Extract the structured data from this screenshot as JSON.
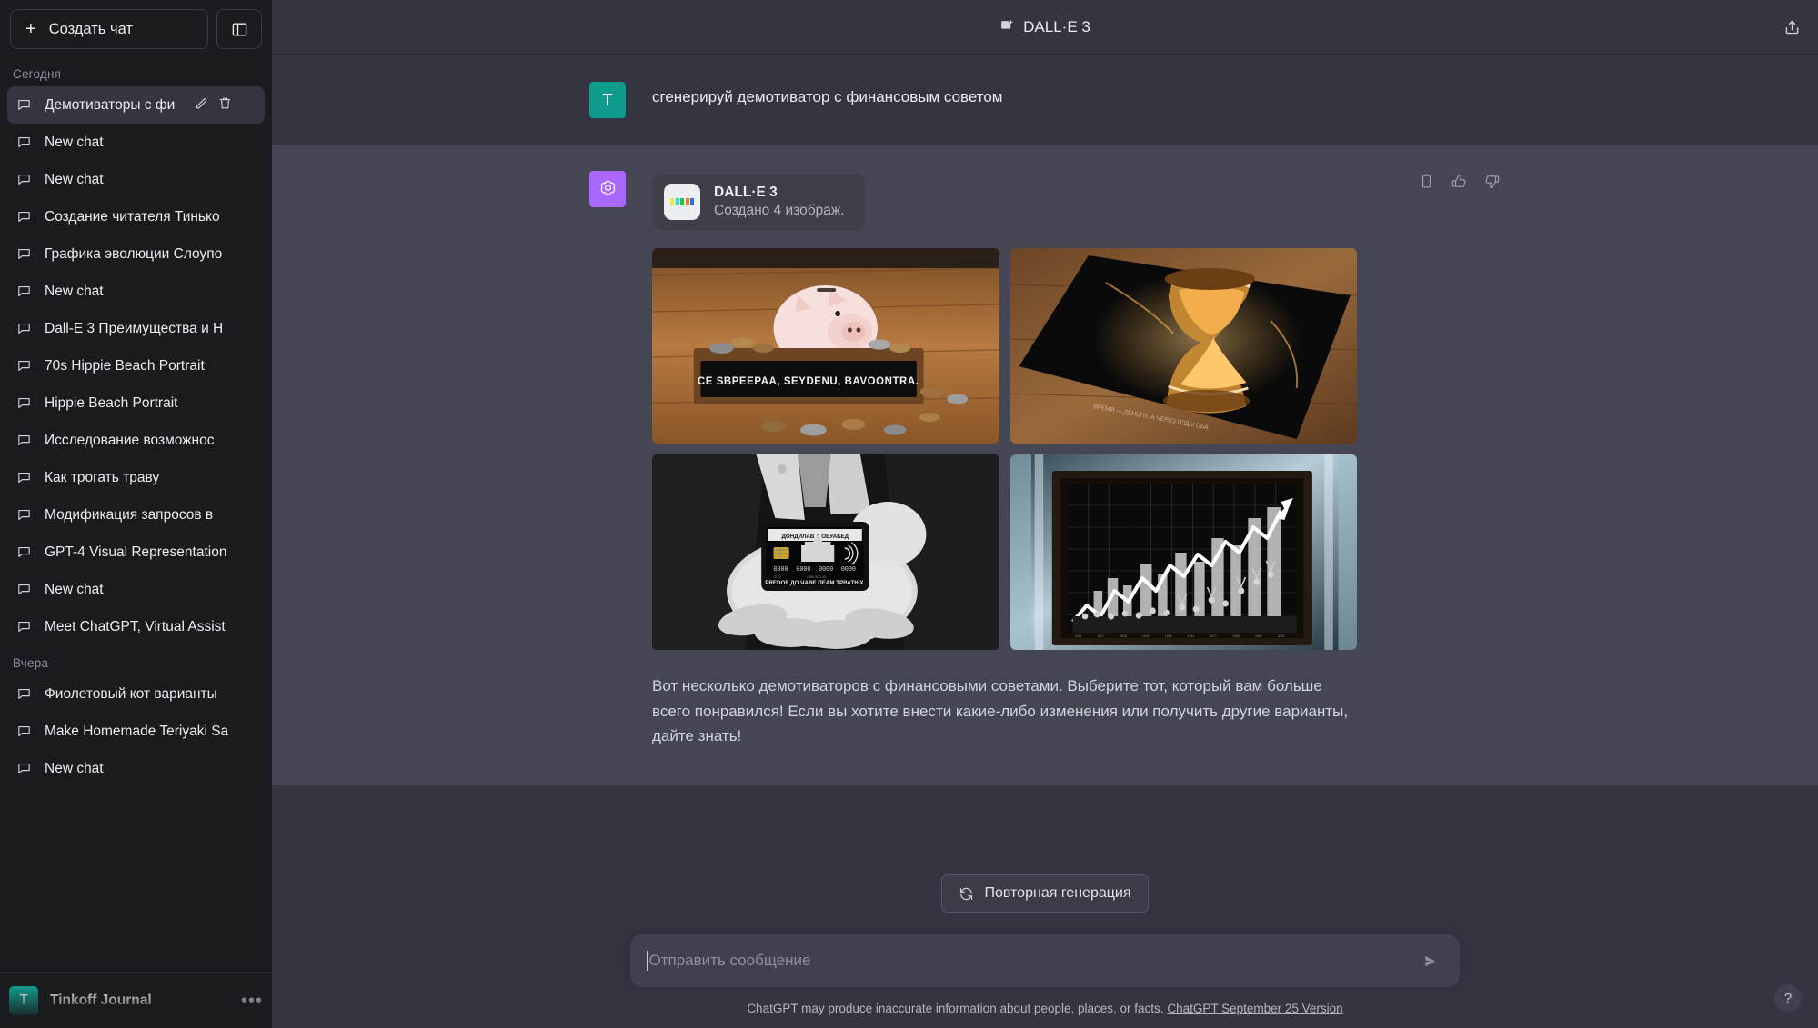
{
  "sidebar": {
    "new_chat_label": "Создать чат",
    "plus_icon": "plus-icon",
    "collapse_icon": "panel-toggle-icon",
    "groups": [
      {
        "label": "Сегодня",
        "items": [
          {
            "label": "Демотиваторы с фи",
            "active": true
          },
          {
            "label": "New chat",
            "active": false
          },
          {
            "label": "New chat",
            "active": false
          },
          {
            "label": "Создание читателя Тинько",
            "active": false
          },
          {
            "label": "Графика эволюции Слоупо",
            "active": false
          },
          {
            "label": "New chat",
            "active": false
          },
          {
            "label": "Dall-E 3 Преимущества и Н",
            "active": false
          },
          {
            "label": "70s Hippie Beach Portrait",
            "active": false
          },
          {
            "label": "Hippie Beach Portrait",
            "active": false
          },
          {
            "label": "Исследование возможнос",
            "active": false
          },
          {
            "label": "Как трогать траву",
            "active": false
          },
          {
            "label": "Модификация запросов в",
            "active": false
          },
          {
            "label": "GPT-4 Visual Representation",
            "active": false
          },
          {
            "label": "New chat",
            "active": false
          },
          {
            "label": "Meet ChatGPT, Virtual Assist",
            "active": false
          }
        ]
      },
      {
        "label": "Вчера",
        "items": [
          {
            "label": "Фиолетовый кот варианты",
            "active": false
          },
          {
            "label": "Make Homemade Teriyaki Sa",
            "active": false
          },
          {
            "label": "New chat",
            "active": false
          }
        ]
      }
    ],
    "account": {
      "avatar_letter": "T",
      "name": "Tinkoff Journal",
      "menu_label": "•••"
    }
  },
  "topbar": {
    "title": "DALL·E 3",
    "model_icon": "image-plus-icon",
    "share_icon": "share-upload-icon"
  },
  "conversation": {
    "user_message": {
      "avatar_letter": "T",
      "text": "сгенерируй демотиватор с финансовым советом"
    },
    "assistant_message": {
      "avatar_icon": "openai-logo-icon",
      "plugin": {
        "name": "DALL·E 3",
        "status": "Создано 4 изображ.",
        "icon": "dalle-color-bars-icon",
        "bar_colors": [
          "#f5e642",
          "#27dbe5",
          "#2bbf4a",
          "#f07f1c",
          "#2f6fe0"
        ]
      },
      "images": [
        {
          "alt": "piggy-bank-on-coins-demotivator",
          "caption": "CE SBPEEPAA, SEYDENU, BAVOONTRA."
        },
        {
          "alt": "golden-hourglass-demotivator",
          "caption": ""
        },
        {
          "alt": "hand-holding-credit-card-demotivator",
          "caption": "ДОНДИЛАВ А ОЕУАБЕД"
        },
        {
          "alt": "rising-stock-chart-framed-demotivator",
          "caption": ""
        }
      ],
      "reply_text": "Вот несколько демотиваторов с финансовыми советами. Выберите тот, который вам больше всего понравился! Если вы хотите внести какие-либо изменения или получить другие варианты, дайте знать!",
      "actions": [
        "copy-icon",
        "thumbs-up-icon",
        "thumbs-down-icon"
      ]
    }
  },
  "composer": {
    "regenerate_label": "Повторная генерация",
    "regenerate_icon": "refresh-icon",
    "input_placeholder": "Отправить сообщение",
    "input_value": "",
    "send_icon": "send-arrow-icon",
    "footnote_text": "ChatGPT may produce inaccurate information about people, places, or facts.",
    "footnote_link": "ChatGPT September 25 Version",
    "help_label": "?"
  },
  "colors": {
    "sidebar_bg": "#1a1b1e",
    "main_bg": "#343541",
    "bot_bg": "#444654",
    "accent_teal": "#0f9b8e",
    "accent_purple": "#ab68ff"
  }
}
